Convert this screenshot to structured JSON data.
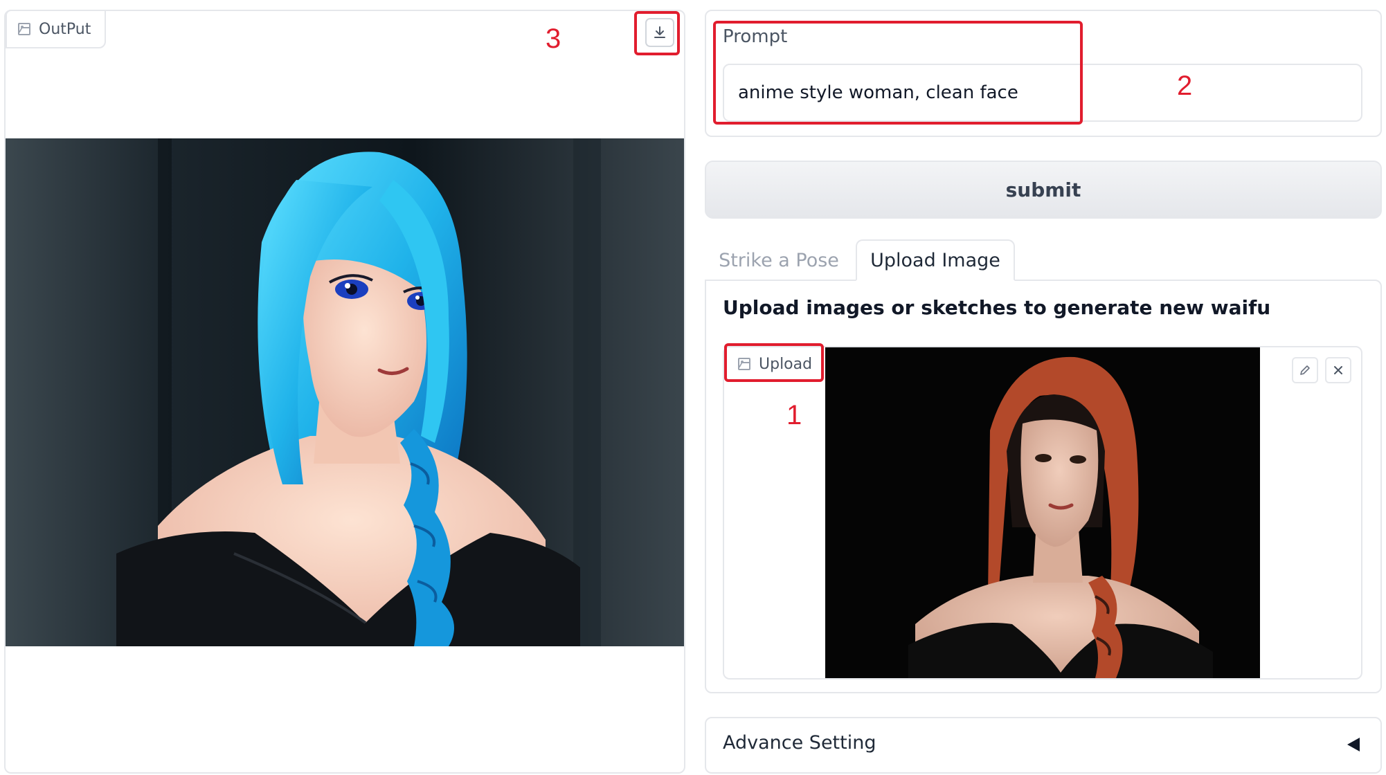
{
  "output": {
    "label": "OutPut"
  },
  "prompt": {
    "label": "Prompt",
    "value": "anime style woman, clean face"
  },
  "submit": {
    "label": "submit"
  },
  "tabs": [
    {
      "label": "Strike a Pose",
      "active": false
    },
    {
      "label": "Upload Image",
      "active": true
    }
  ],
  "upload": {
    "heading": "Upload images or sketches to generate new waifu",
    "label": "Upload"
  },
  "advance": {
    "label": "Advance Setting"
  },
  "annotations": [
    "1",
    "2",
    "3"
  ],
  "colors": {
    "annotation": "#e11d2e",
    "panel_border": "#e5e7eb"
  },
  "icons": [
    "image-icon",
    "download-icon",
    "edit-icon",
    "close-icon",
    "collapse-arrow-icon"
  ]
}
